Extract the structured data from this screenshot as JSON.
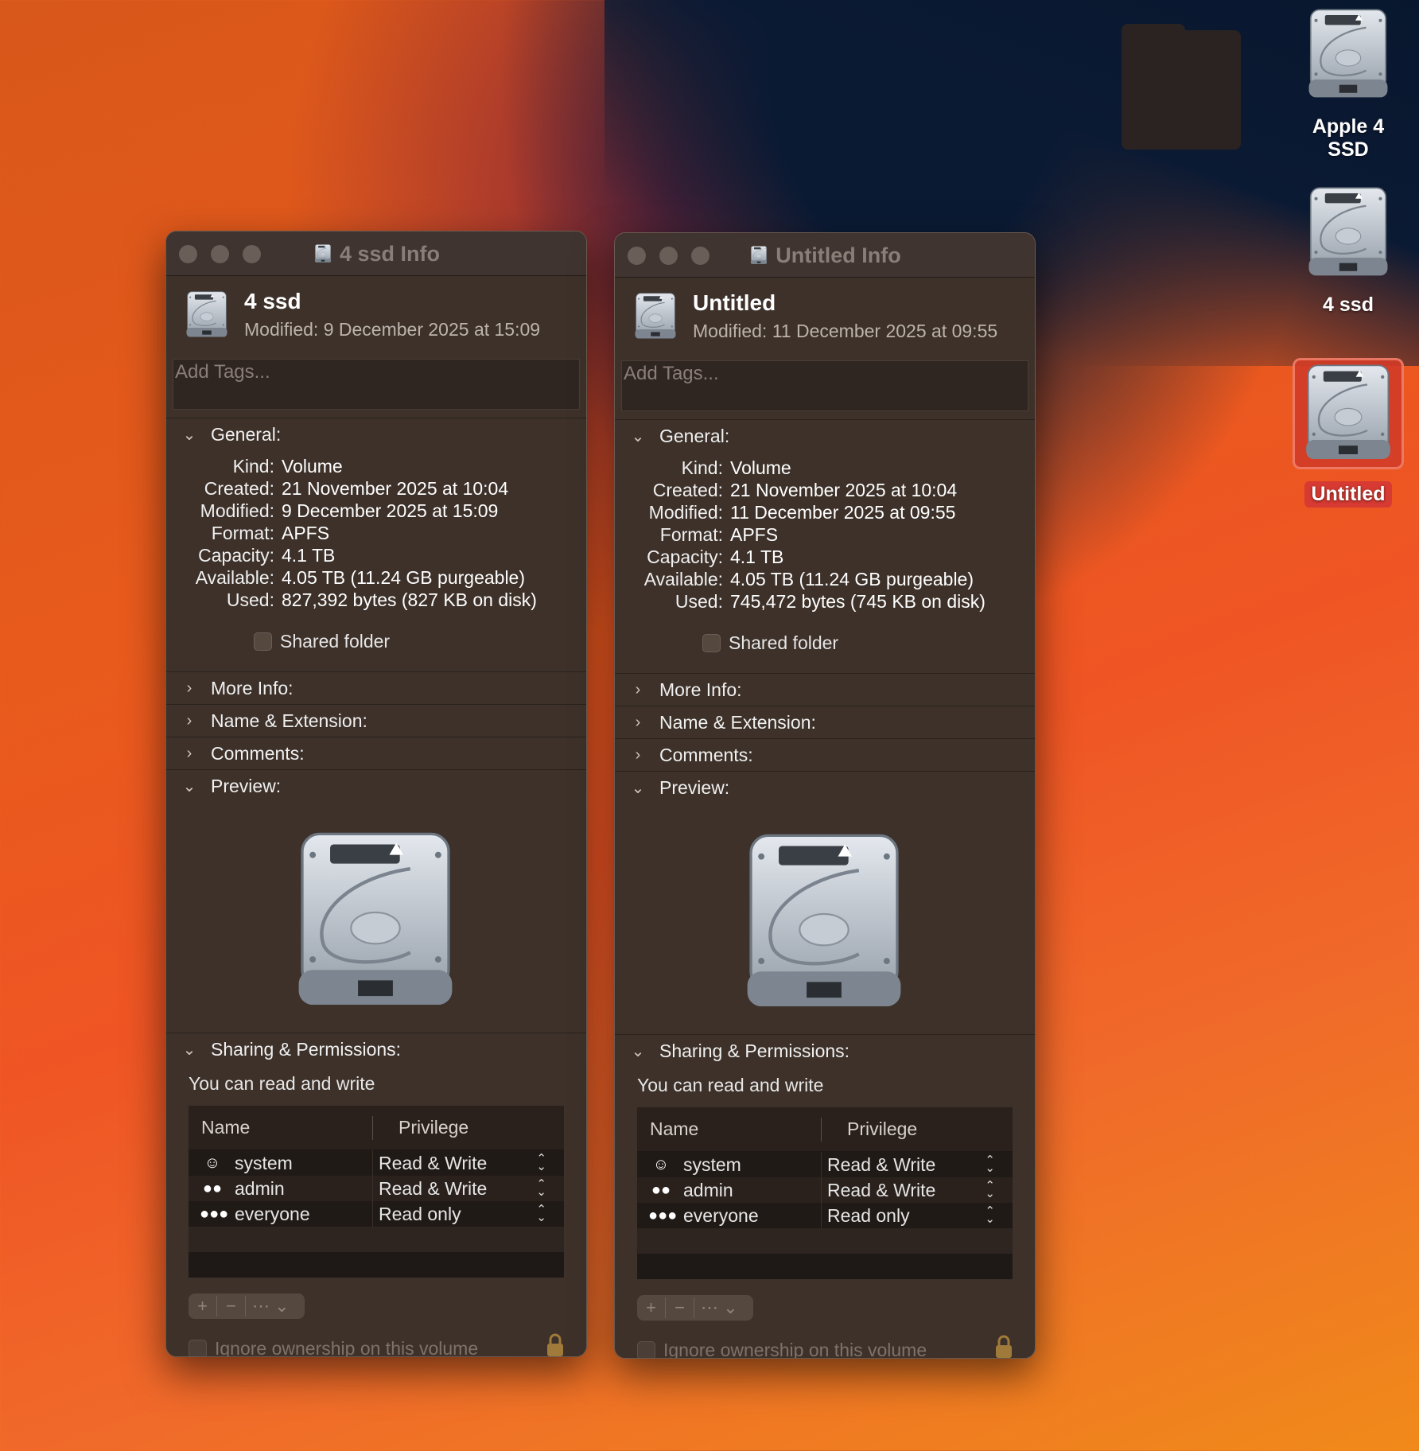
{
  "desktop": {
    "icons": [
      {
        "label": "Apple 4 SSD",
        "icon": "internal-disk-icon",
        "selected": false
      },
      {
        "label": "4 ssd",
        "icon": "internal-disk-icon",
        "selected": false
      },
      {
        "label": "Untitled",
        "icon": "internal-disk-icon",
        "selected": true
      }
    ]
  },
  "windows": [
    {
      "title": "4 ssd Info",
      "name": "4 ssd",
      "modified_header": "Modified:  9 December 2025 at 15:09",
      "tags_placeholder": "Add Tags...",
      "general": {
        "label": "General:",
        "rows": [
          {
            "k": "Kind:",
            "v": "Volume"
          },
          {
            "k": "Created:",
            "v": "21 November 2025 at 10:04"
          },
          {
            "k": "Modified:",
            "v": "9 December 2025 at 15:09"
          },
          {
            "k": "Format:",
            "v": "APFS"
          },
          {
            "k": "Capacity:",
            "v": "4.1 TB"
          },
          {
            "k": "Available:",
            "v": "4.05 TB (11.24 GB purgeable)"
          },
          {
            "k": "Used:",
            "v": "827,392 bytes (827 KB on disk)"
          }
        ],
        "shared_folder": "Shared folder"
      },
      "sections": {
        "more_info": "More Info:",
        "name_ext": "Name & Extension:",
        "comments": "Comments:",
        "preview": "Preview:",
        "sharing": "Sharing & Permissions:"
      },
      "permission_msg": "You can read and write",
      "table": {
        "col_name": "Name",
        "col_privilege": "Privilege",
        "rows": [
          {
            "user": "system",
            "privilege": "Read & Write",
            "icon": "user-icon"
          },
          {
            "user": "admin",
            "privilege": "Read & Write",
            "icon": "group-icon"
          },
          {
            "user": "everyone",
            "privilege": "Read only",
            "icon": "everyone-icon"
          }
        ]
      },
      "ignore_ownership": "Ignore ownership on this volume"
    },
    {
      "title": "Untitled Info",
      "name": "Untitled",
      "modified_header": "Modified:  11 December 2025 at 09:55",
      "tags_placeholder": "Add Tags...",
      "general": {
        "label": "General:",
        "rows": [
          {
            "k": "Kind:",
            "v": "Volume"
          },
          {
            "k": "Created:",
            "v": "21 November 2025 at 10:04"
          },
          {
            "k": "Modified:",
            "v": "11 December 2025 at 09:55"
          },
          {
            "k": "Format:",
            "v": "APFS"
          },
          {
            "k": "Capacity:",
            "v": "4.1 TB"
          },
          {
            "k": "Available:",
            "v": "4.05 TB (11.24 GB purgeable)"
          },
          {
            "k": "Used:",
            "v": "745,472 bytes (745 KB on disk)"
          }
        ],
        "shared_folder": "Shared folder"
      },
      "sections": {
        "more_info": "More Info:",
        "name_ext": "Name & Extension:",
        "comments": "Comments:",
        "preview": "Preview:",
        "sharing": "Sharing & Permissions:"
      },
      "permission_msg": "You can read and write",
      "table": {
        "col_name": "Name",
        "col_privilege": "Privilege",
        "rows": [
          {
            "user": "system",
            "privilege": "Read & Write",
            "icon": "user-icon"
          },
          {
            "user": "admin",
            "privilege": "Read & Write",
            "icon": "group-icon"
          },
          {
            "user": "everyone",
            "privilege": "Read only",
            "icon": "everyone-icon"
          }
        ]
      },
      "ignore_ownership": "Ignore ownership on this volume"
    }
  ]
}
